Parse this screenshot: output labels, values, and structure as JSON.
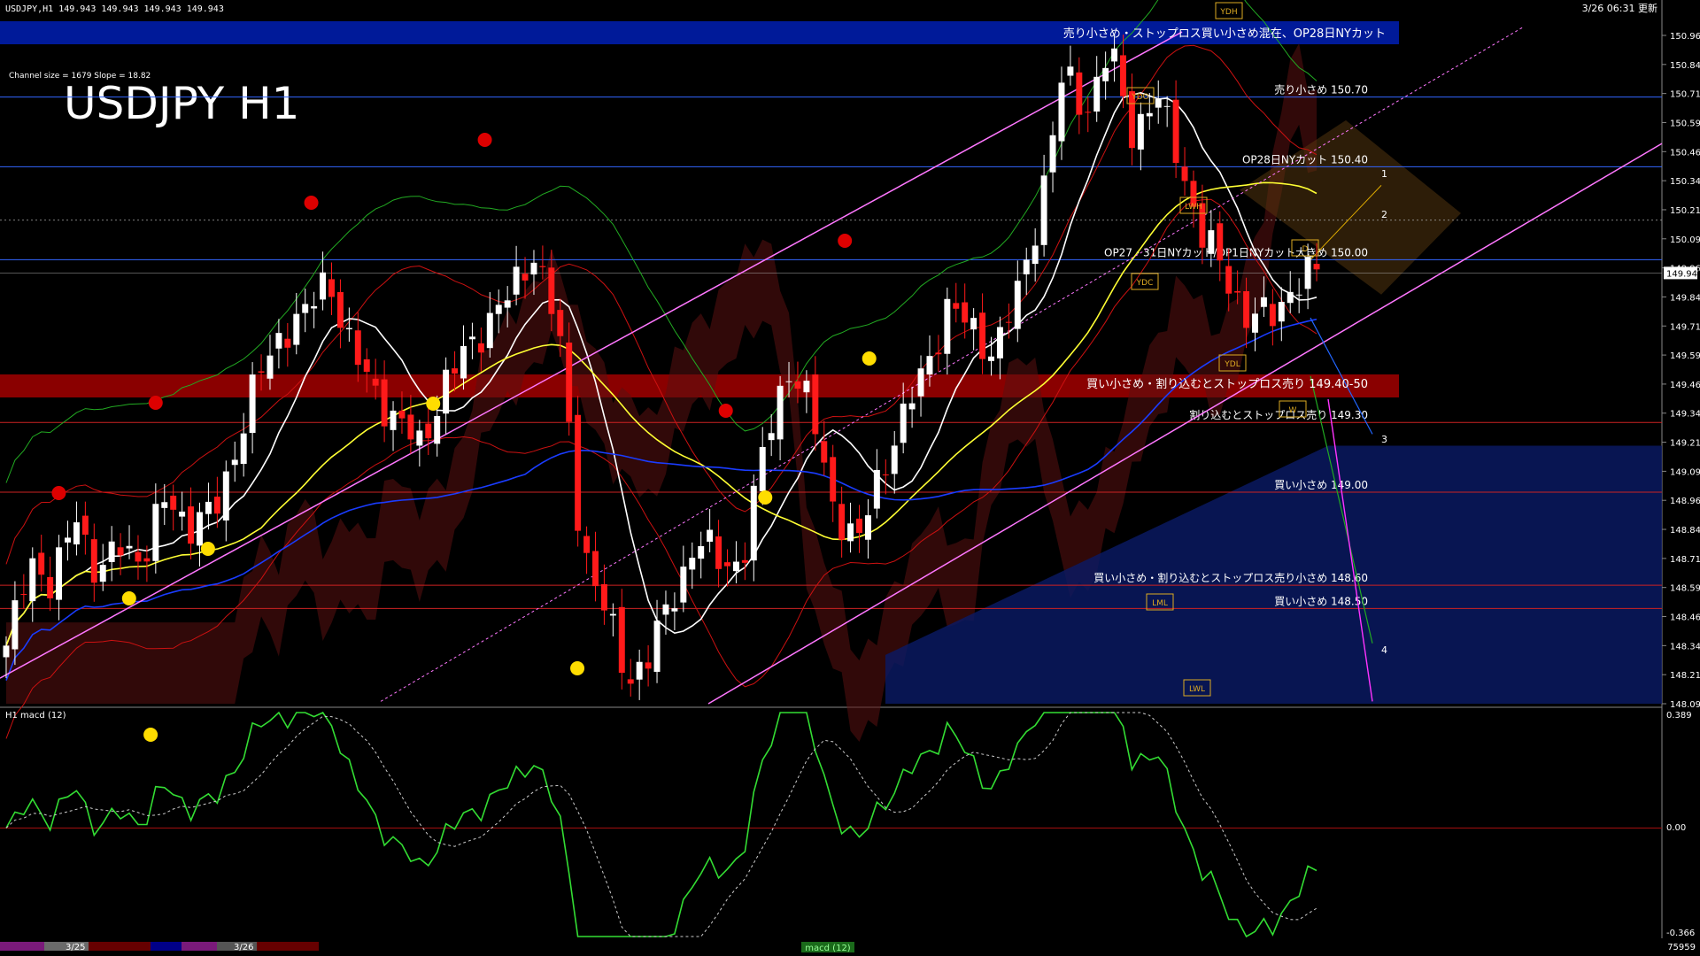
{
  "header": {
    "symbol_info": "USDJPY,H1  149.943 149.943 149.943 149.943",
    "updated": "3/26 06:31 更新",
    "channel_info": "Channel size = 1679 Slope = 18.82",
    "big_title": "USDJPY H1"
  },
  "banners": {
    "top": "売り小さめ・ストップロス買い小さめ混在、OP28日NYカット",
    "mid": "買い小さめ・割り込むとストップロス売り 149.40-50"
  },
  "colors": {
    "blue_band": "#001a99",
    "red_band": "#8a0000",
    "bull": "#ffffff",
    "bear": "#ff1a1a",
    "sma_fast": "#ffffff",
    "sma_mid": "#ffff33",
    "sma_slow": "#1a3cff",
    "channel": "#ff77ff",
    "macd": "#33dd33",
    "macd_neg": "#ff7799",
    "signal": "#cccccc"
  },
  "chart_data": {
    "type": "candlestick",
    "ylim": [
      148.09,
      150.965
    ],
    "y_ticks": [
      150.965,
      150.84,
      150.715,
      150.59,
      150.465,
      150.34,
      150.215,
      150.09,
      149.965,
      149.84,
      149.715,
      149.59,
      149.465,
      149.34,
      149.215,
      149.09,
      148.965,
      148.84,
      148.715,
      148.59,
      148.465,
      148.34,
      148.215,
      148.09
    ],
    "price_tag": "149.943",
    "bars": 150,
    "close_path": [
      148.3,
      148.75,
      148.55,
      148.95,
      148.6,
      148.8,
      148.7,
      149.0,
      148.85,
      148.9,
      149.2,
      149.5,
      149.7,
      149.75,
      149.95,
      149.6,
      149.45,
      149.3,
      149.2,
      149.45,
      149.6,
      149.75,
      149.85,
      150.05,
      149.7,
      148.8,
      148.5,
      148.2,
      148.3,
      148.55,
      148.8,
      148.7,
      148.7,
      149.2,
      149.55,
      149.35,
      148.95,
      148.75,
      149.1,
      149.3,
      149.55,
      149.8,
      149.7,
      149.6,
      149.85,
      150.25,
      150.8,
      150.65,
      150.9,
      150.55,
      150.7,
      150.45,
      150.1,
      149.95,
      149.75,
      149.75,
      149.9,
      149.94
    ],
    "levels": [
      {
        "label": "売り小さめ 150.70",
        "price": 150.7,
        "color": "#3366ff"
      },
      {
        "label": "OP28日NYカット 150.40",
        "price": 150.4,
        "color": "#3366ff"
      },
      {
        "label": "OP27・31日NYカット/OP1日NYカット大きめ 150.00",
        "price": 150.0,
        "color": "#3366ff"
      },
      {
        "label": "割り込むとストップロス売り 149.30",
        "price": 149.3,
        "color": "#cc2222"
      },
      {
        "label": "買い小さめ 149.00",
        "price": 149.0,
        "color": "#cc2222"
      },
      {
        "label": "買い小さめ・割り込むとストップロス売り小さめ 148.60",
        "price": 148.6,
        "color": "#cc2222"
      },
      {
        "label": "買い小さめ 148.50",
        "price": 148.5,
        "color": "#cc2222"
      }
    ],
    "markers": [
      "YDH",
      "YDO",
      "LWH",
      "YDC",
      "YDL",
      "LML",
      "LWL",
      "W",
      "D"
    ],
    "forecast_labels": [
      "1",
      "2",
      "3",
      "4"
    ]
  },
  "macd_panel": {
    "title": "H1  macd (12)",
    "ylim": [
      -0.366,
      0.389
    ],
    "top_tick": "0.389",
    "zero_tick": "0.00",
    "bottom_tick": "-0.366"
  },
  "footer": {
    "date1": "3/25",
    "date2": "3/26",
    "center_label": "macd (12)",
    "bar_count": "75959"
  }
}
